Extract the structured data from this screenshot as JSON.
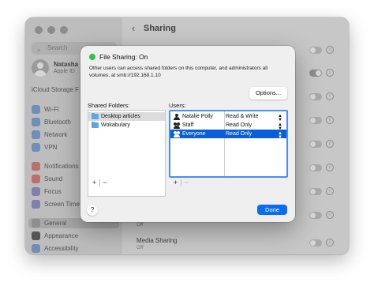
{
  "window": {
    "title": "Sharing",
    "search_placeholder": "Search",
    "account": {
      "name": "Natasha",
      "subtitle": "Apple ID"
    },
    "storage_label": "iCloud Storage F",
    "sidebar_items": [
      {
        "label": "Wi-Fi",
        "color": "#6f8fb8"
      },
      {
        "label": "Bluetooth",
        "color": "#6f8fb8"
      },
      {
        "label": "Network",
        "color": "#6f8fb8"
      },
      {
        "label": "VPN",
        "color": "#6f8fb8"
      },
      {
        "label": "Notifications",
        "color": "#b86f6f"
      },
      {
        "label": "Sound",
        "color": "#b86f6f"
      },
      {
        "label": "Focus",
        "color": "#7f7fb0"
      },
      {
        "label": "Screen Time",
        "color": "#7f7fb0"
      },
      {
        "label": "General",
        "color": "#8e8e8e"
      },
      {
        "label": "Appearance",
        "color": "#555555"
      },
      {
        "label": "Accessibility",
        "color": "#6f8fb8"
      }
    ],
    "rows": [
      {
        "title": "Media Sharing",
        "subtitle": "Off"
      },
      {
        "subtitle_above": "Off"
      }
    ]
  },
  "sheet": {
    "title": "File Sharing: On",
    "status_color": "#32c24a",
    "description": "Other users can access shared folders on this computer, and administrators all volumes, at smb://192.168.1.10",
    "options_label": "Options...",
    "shared_folders_label": "Shared Folders:",
    "users_label": "Users:",
    "folders": [
      "Desktop articles",
      "Wokabulary"
    ],
    "users": [
      {
        "name": "Natalie Polly",
        "permission": "Read & Write",
        "icon": "person-icon"
      },
      {
        "name": "Staff",
        "permission": "Read Only",
        "icon": "group-icon"
      },
      {
        "name": "Everyone",
        "permission": "Read Only",
        "icon": "everyone-icon"
      }
    ],
    "add_symbol": "+",
    "remove_symbol": "−",
    "help_label": "?",
    "done_label": "Done"
  }
}
